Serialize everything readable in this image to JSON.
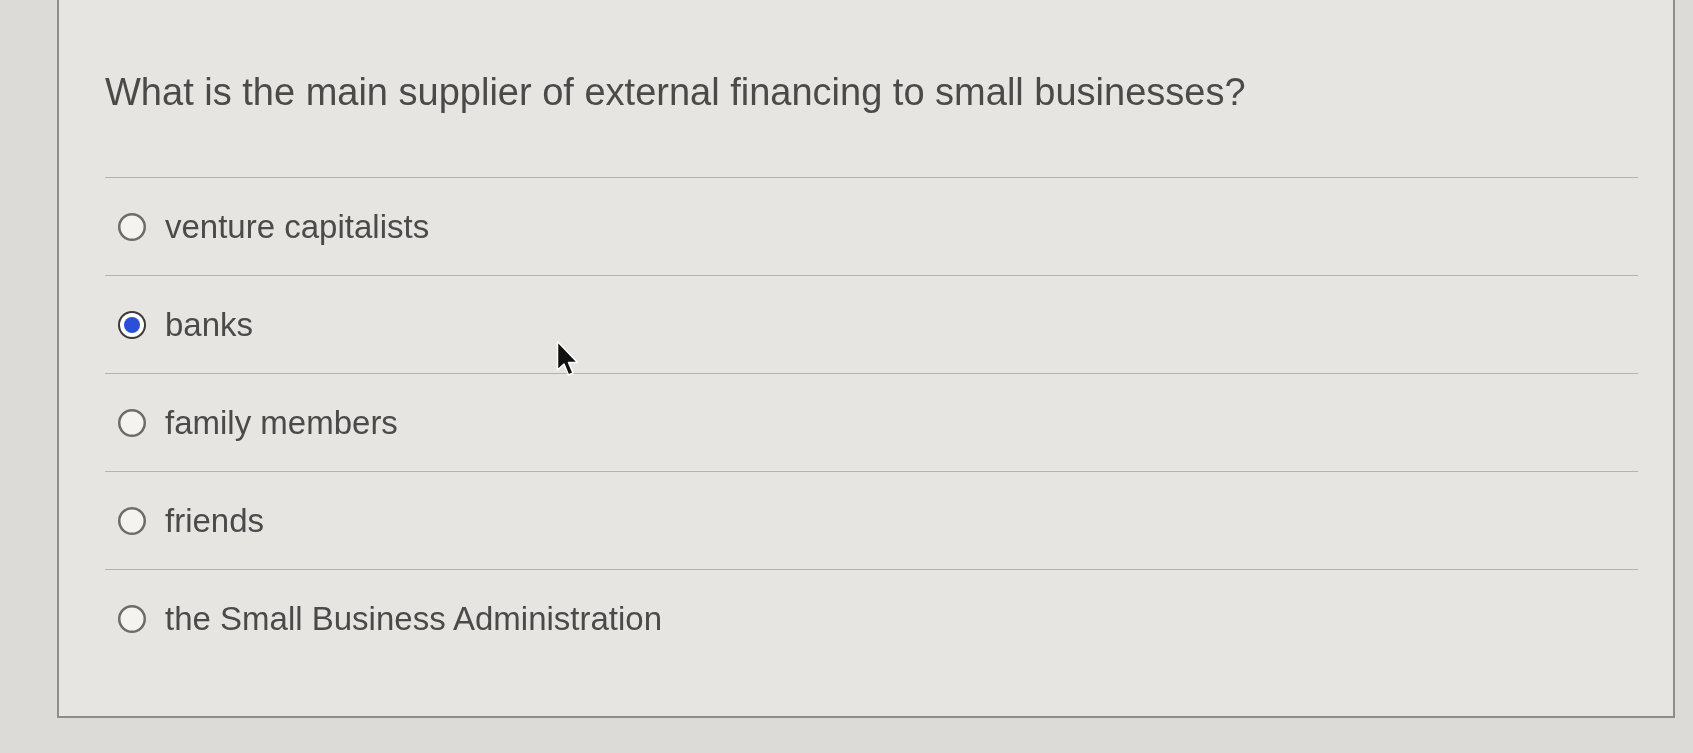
{
  "question": {
    "text": "What is the main supplier of external financing to small businesses?"
  },
  "options": [
    {
      "label": "venture capitalists",
      "selected": false
    },
    {
      "label": "banks",
      "selected": true
    },
    {
      "label": "family members",
      "selected": false
    },
    {
      "label": "friends",
      "selected": false
    },
    {
      "label": "the Small Business Administration",
      "selected": false
    }
  ]
}
